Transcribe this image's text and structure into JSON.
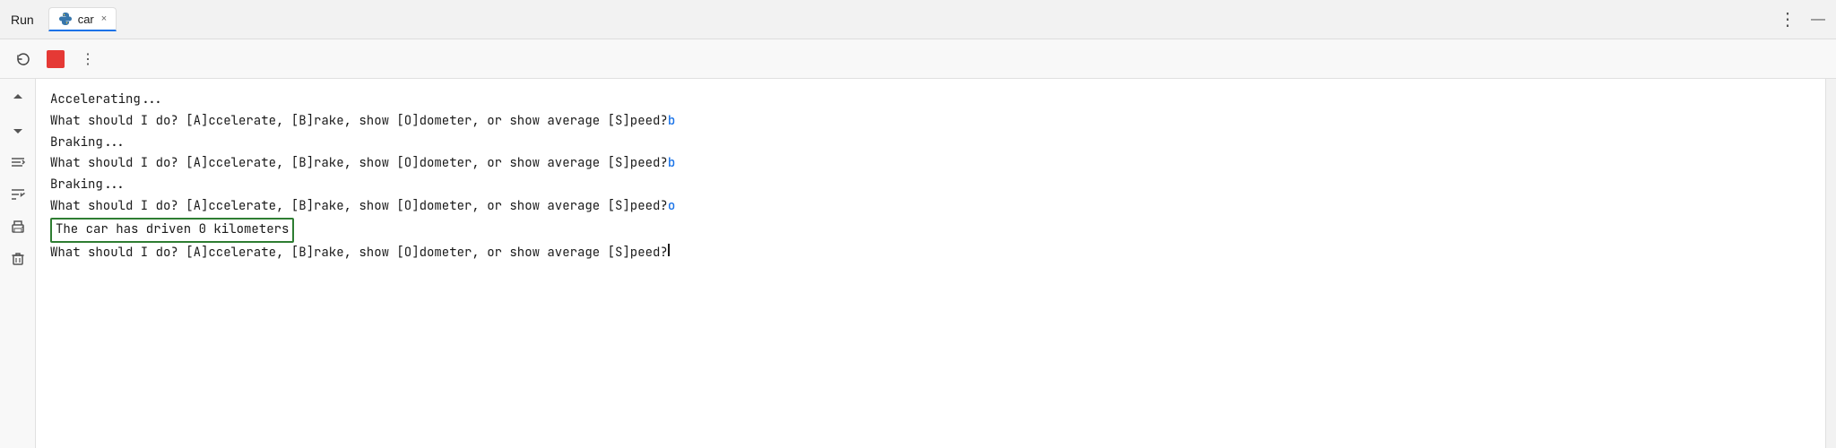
{
  "titleBar": {
    "run_label": "Run",
    "tab_name": "car",
    "tab_close": "×",
    "more_icon": "⋮",
    "minimize_icon": "—"
  },
  "toolbar": {
    "rerun_icon": "↺",
    "stop_icon": "",
    "more_icon": "⋮",
    "scroll_up_icon": "↑",
    "scroll_down_icon": "↓",
    "wrap_icon": "≡",
    "sort_icon": "⇩",
    "print_icon": "🖨",
    "trash_icon": "🗑"
  },
  "console": {
    "lines": [
      {
        "id": "line1",
        "text": "Accelerating...",
        "type": "normal"
      },
      {
        "id": "line2",
        "text": "What should I do? [A]ccelerate, [B]rake, show [O]dometer, or show average [S]peed?",
        "suffix": "b",
        "type": "prompt"
      },
      {
        "id": "line3",
        "text": "Braking...",
        "type": "normal"
      },
      {
        "id": "line4",
        "text": "What should I do? [A]ccelerate, [B]rake, show [O]dometer, or show average [S]peed?",
        "suffix": "b",
        "type": "prompt"
      },
      {
        "id": "line5",
        "text": "Braking...",
        "type": "normal"
      },
      {
        "id": "line6",
        "text": "What should I do? [A]ccelerate, [B]rake, show [O]dometer, or show average [S]peed?",
        "suffix": "o",
        "type": "prompt"
      },
      {
        "id": "line7",
        "text": "The car has driven 0 kilometers",
        "type": "highlighted"
      },
      {
        "id": "line8",
        "text": "What should I do? [A]ccelerate, [B]rake, show [O]dometer, or show average [S]peed?",
        "suffix": "",
        "type": "prompt-cursor"
      }
    ]
  },
  "colors": {
    "accent_blue": "#1a73e8",
    "highlight_green": "#2e7d32",
    "user_input_blue": "#1a73e8",
    "text_normal": "#1a1a1a"
  }
}
